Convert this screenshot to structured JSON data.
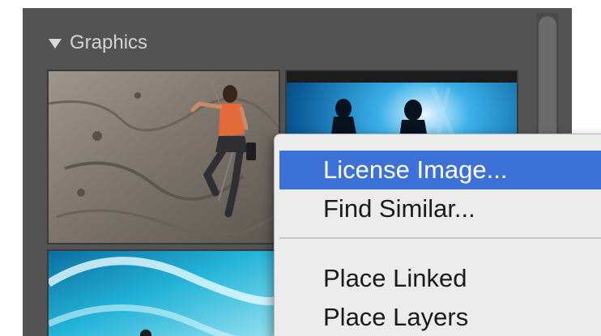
{
  "panel": {
    "section_title": "Graphics",
    "disclosure_icon": "disclosure-triangle-down"
  },
  "thumbnails": [
    {
      "subject": "rock climber on cliff"
    },
    {
      "subject": "underwater divers silhouette"
    },
    {
      "subject": "ocean wave surfer"
    }
  ],
  "context_menu": {
    "items": [
      {
        "label": "License Image...",
        "highlighted": true
      },
      {
        "label": "Find Similar...",
        "highlighted": false
      },
      {
        "label": "Place Linked",
        "highlighted": false
      },
      {
        "label": "Place Layers",
        "highlighted": false
      }
    ]
  },
  "colors": {
    "panel_bg": "#535353",
    "menu_bg": "#ececec",
    "highlight": "#3c72d8"
  }
}
